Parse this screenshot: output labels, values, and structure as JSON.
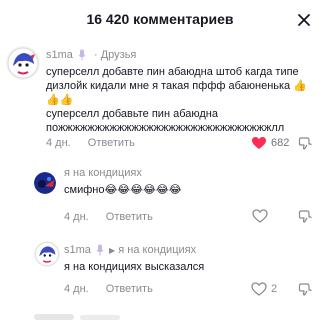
{
  "header": {
    "title": "16 420 комментариев"
  },
  "comments": [
    {
      "username": "s1ma",
      "relation": "Друзья",
      "text_lines": [
        "суперселл добавте пин абаюдна штоб кагда типе",
        "дизлойк кидали мне я такая пффф абаюненька 👍👍👍",
        "суперселл добавьте пин абаюдна",
        "пожжжжжжжжжжжжжжжжжжжжжжжжжжжжжлл"
      ],
      "time": "4 дн.",
      "reply_label": "Ответить",
      "likes": "682",
      "liked": true,
      "like_color": "#fe2c55"
    },
    {
      "username": "я на кондициях",
      "text": "смифно😂😂😂😂😂😂",
      "time": "4 дн.",
      "reply_label": "Ответить"
    },
    {
      "username": "s1ma",
      "reply_to": "я на кондициях",
      "text": "я на кондициях высказался",
      "time": "4 дн.",
      "reply_label": "Ответить",
      "likes": "2"
    }
  ]
}
